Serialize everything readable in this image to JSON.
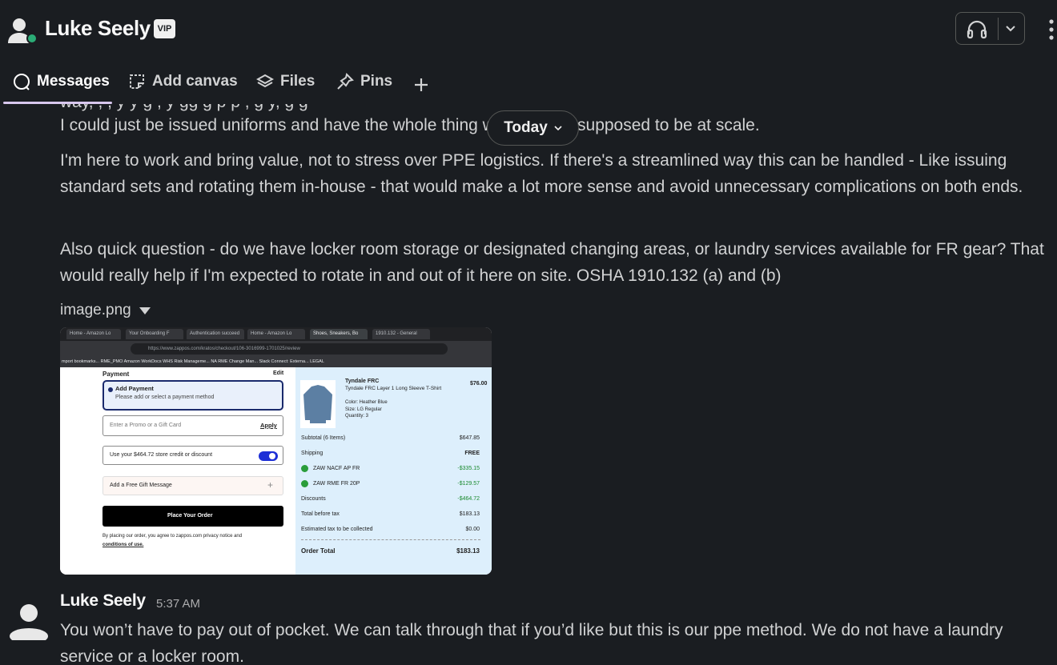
{
  "header": {
    "name": "Luke Seely",
    "badge": "VIP"
  },
  "tabs": [
    {
      "label": "Messages"
    },
    {
      "label": "Add canvas"
    },
    {
      "label": "Files"
    },
    {
      "label": "Pins"
    }
  ],
  "date_divider": "Today",
  "messages": {
    "cutoff_line": "way,                               ,                 ,               y                         y   g          ,  y   gg   g     p          p      ,         g         y,            g   g",
    "para1": "I could just be issued uniforms and have the whole thing work like it's supposed to be at scale.",
    "para2": "I'm here to work and bring value, not to stress over PPE logistics. If there's a streamlined way this can be handled - Like issuing standard sets and rotating them in-house - that would make a lot more sense and avoid unnecessary complications on both ends.",
    "para3": "Also quick question - do we have locker room storage or designated changing areas, or laundry services available for FR gear? That would really help if I'm expected to rotate in and out of it here on site. OSHA 1910.132 (a) and (b)",
    "attachment_name": "image.png",
    "reply": {
      "author": "Luke Seely",
      "time": "5:37 AM",
      "text": "You won’t have to pay out of pocket. We can talk through that if you’d like but this is our ppe method. We do not have a laundry service or a locker room."
    }
  },
  "screenshot": {
    "browser_tabs": [
      "Home - Amazon Lo",
      "Your Onboarding F",
      "Authentication succeed",
      "Home - Amazon Lo",
      "Shoes, Sneakers, Bo",
      "1910.132 - General"
    ],
    "url": "https://www.zappos.com/kratos/checkout/106-3016999-1701025/review",
    "bookmarks": "mport bookmarks...   RME_PMO   Amazon WorkDocs   WHS Risk Manageme...   NA RME Change Man...   Slack Connect: Externa...   LEGAL",
    "payment_heading": "Payment",
    "edit": "Edit",
    "add_payment": "Add Payment",
    "add_payment_sub": "Please add or select a payment method",
    "promo_placeholder": "Enter a Promo or a Gift Card",
    "apply": "Apply",
    "store_credit": "Use your $464.72 store credit or discount",
    "gift_message": "Add a Free Gift Message",
    "place_order": "Place Your Order",
    "legal_1": "By placing our order, you agree to zappos.com privacy notice and",
    "legal_2": "conditions of use.",
    "product_brand": "Tyndale FRC",
    "product_price": "$76.00",
    "product_name": "Tyndale FRC Layer 1 Long Sleeve T-Shirt",
    "product_color": "Color: Heather Blue",
    "product_size": "Size: LG Regular",
    "product_qty": "Quantity: 3",
    "summary": [
      {
        "label": "Subtotal (6 Items)",
        "value": "$647.85"
      },
      {
        "label": "Shipping",
        "value": "FREE"
      },
      {
        "label": "ZAW NACF AP FR",
        "value": "-$335.15"
      },
      {
        "label": "ZAW RME FR 20P",
        "value": "-$129.57"
      },
      {
        "label": "Discounts",
        "value": "-$464.72"
      },
      {
        "label": "Total before tax",
        "value": "$183.13"
      },
      {
        "label": "Estimated tax to be collected",
        "value": "$0.00"
      }
    ],
    "order_total_label": "Order Total",
    "order_total_value": "$183.13"
  },
  "colors": {
    "background": "#1a1d21",
    "accent_underline": "#d8c7ee",
    "presence": "#2bac76"
  }
}
